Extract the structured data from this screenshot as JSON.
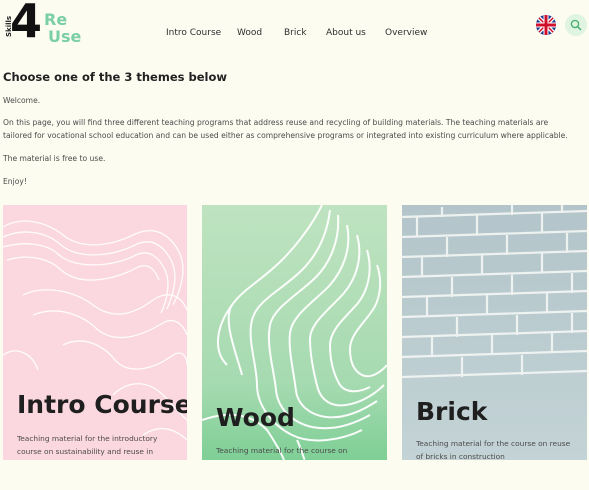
{
  "logo": {
    "side_text": "Skills",
    "numeral": "4",
    "re": "Re",
    "use": "Use"
  },
  "nav": {
    "items": [
      "Intro Course",
      "Wood",
      "Brick",
      "About us",
      "Overview"
    ]
  },
  "language": {
    "icon": "uk-flag-icon"
  },
  "search": {
    "icon": "search-icon"
  },
  "intro": {
    "title": "Choose one of the 3 themes below",
    "welcome": "Welcome.",
    "description": "On this page, you will find three different teaching programs that address reuse and recycling of building materials. The teaching materials are tailored for vocational school education and can be used either as comprehensive programs or integrated into existing curriculum where applicable.",
    "free": "The material is free to use.",
    "enjoy": "Enjoy!"
  },
  "cards": [
    {
      "title": "Intro Course",
      "description": "Teaching material for the introductory course on sustainability and reuse in construction",
      "color": "#fbd7df"
    },
    {
      "title": "Wood",
      "description": "Teaching material for the course on reusing wood in construction",
      "color": "#a8dbb0"
    },
    {
      "title": "Brick",
      "description": "Teaching material for the course on reuse of bricks in construction",
      "color": "#b5c7cc"
    }
  ],
  "colors": {
    "background": "#fdfcf1",
    "accent": "#7bcfa5"
  }
}
